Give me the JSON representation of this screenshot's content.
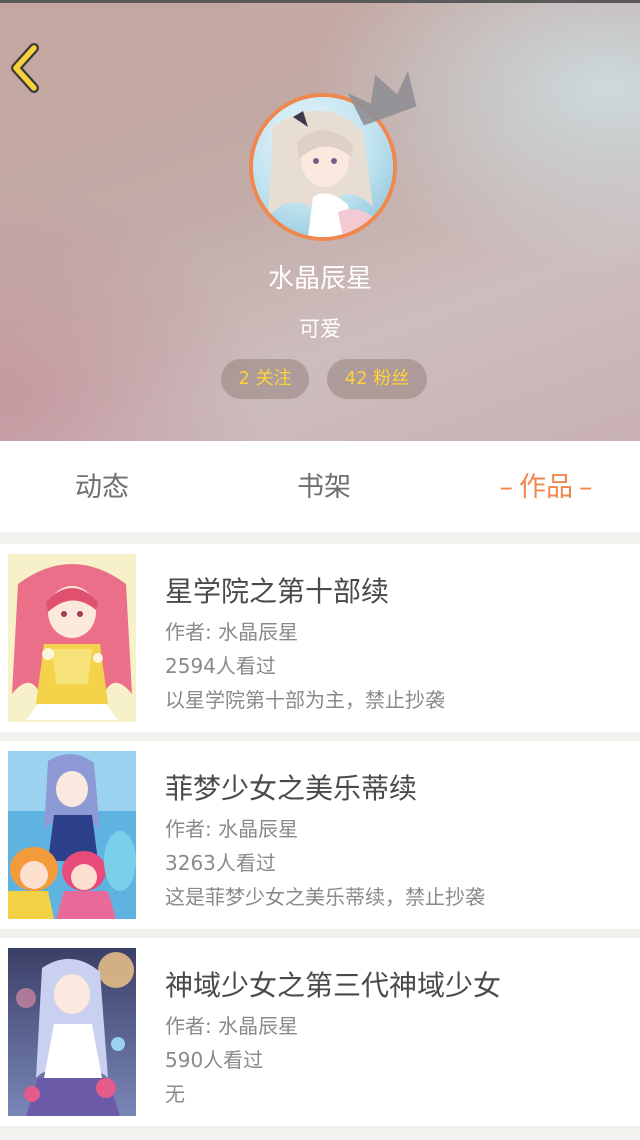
{
  "profile": {
    "nickname": "水晶辰星",
    "signature": "可爱",
    "follow_label": "2 关注",
    "fans_label": "42 粉丝"
  },
  "tabs": [
    {
      "label": "动态"
    },
    {
      "label": "书架"
    },
    {
      "label": "作品",
      "active": true
    }
  ],
  "tab_dash": "–",
  "works": [
    {
      "title": "星学院之第十部续",
      "author": "作者: 水晶辰星",
      "views": "2594人看过",
      "description": "以星学院第十部为主，禁止抄袭"
    },
    {
      "title": "菲梦少女之美乐蒂续",
      "author": "作者: 水晶辰星",
      "views": "3263人看过",
      "description": "这是菲梦少女之美乐蒂续，禁止抄袭"
    },
    {
      "title": "神域少女之第三代神域少女",
      "author": "作者: 水晶辰星",
      "views": "590人看过",
      "description": "无"
    }
  ],
  "colors": {
    "accent": "#f0874e",
    "stat_text": "#ffd23a",
    "back_arrow": "#f5d23a"
  },
  "icons": {
    "back": "chevron-left-icon",
    "crown": "crown-icon"
  }
}
